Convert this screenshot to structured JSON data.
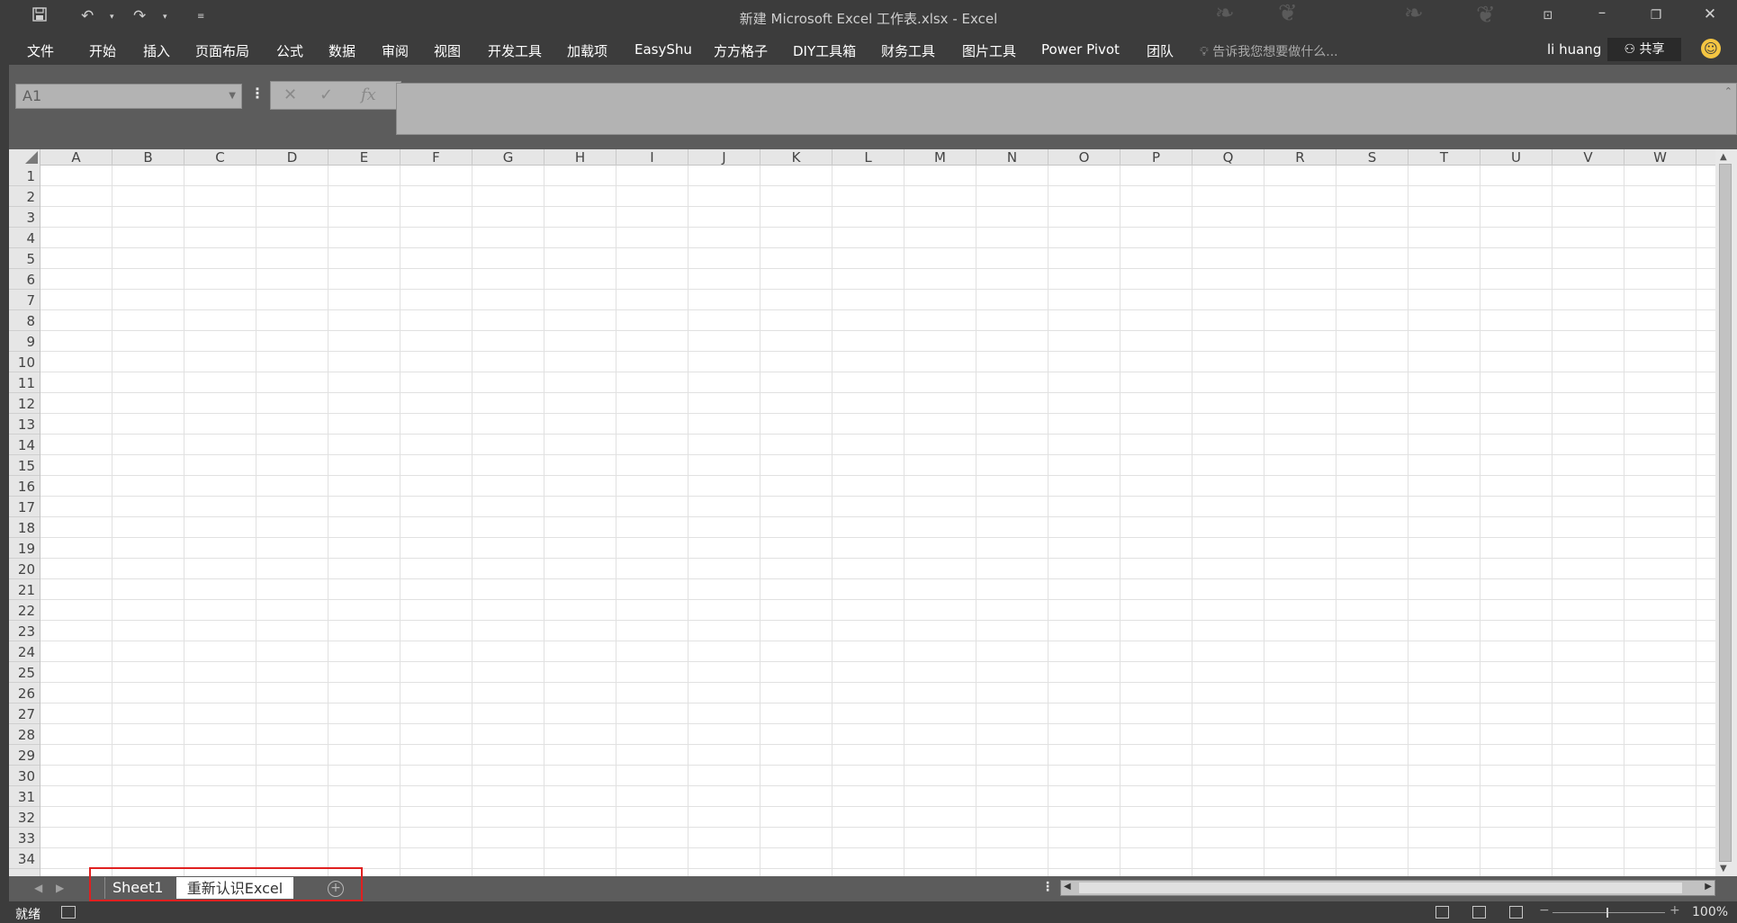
{
  "window": {
    "title": "新建 Microsoft Excel 工作表.xlsx - Excel",
    "qat": {
      "save_icon": "save-icon",
      "undo_icon": "undo-icon",
      "redo_icon": "redo-icon",
      "customize_icon": "customize-icon"
    },
    "controls": {
      "ribbon_display_icon": "ribbon-display-icon",
      "minimize_icon": "minimize-icon",
      "restore_icon": "restore-icon",
      "close_icon": "close-icon"
    }
  },
  "ribbon": {
    "tabs": [
      "文件",
      "开始",
      "插入",
      "页面布局",
      "公式",
      "数据",
      "审阅",
      "视图",
      "开发工具",
      "加载项",
      "EasyShu",
      "方方格子",
      "DIY工具箱",
      "财务工具",
      "图片工具",
      "Power Pivot",
      "团队"
    ],
    "tell_me": "告诉我您想要做什么...",
    "user": "li huang",
    "share": "共享"
  },
  "formula": {
    "name_box": "A1",
    "cancel": "✕",
    "enter": "✓",
    "fx": "fx",
    "value": ""
  },
  "grid": {
    "columns": [
      "A",
      "B",
      "C",
      "D",
      "E",
      "F",
      "G",
      "H",
      "I",
      "J",
      "K",
      "L",
      "M",
      "N",
      "O",
      "P",
      "Q",
      "R",
      "S",
      "T",
      "U",
      "V",
      "W"
    ],
    "rows": [
      "1",
      "2",
      "3",
      "4",
      "5",
      "6",
      "7",
      "8",
      "9",
      "10",
      "11",
      "12",
      "13",
      "14",
      "15",
      "16",
      "17",
      "18",
      "19",
      "20",
      "21",
      "22",
      "23",
      "24",
      "25",
      "26",
      "27",
      "28",
      "29",
      "30",
      "31",
      "32",
      "33",
      "34"
    ]
  },
  "sheets": {
    "tabs": [
      "Sheet1",
      "重新认识Excel"
    ],
    "active": "重新认识Excel",
    "highlight_color": "#e02020"
  },
  "status": {
    "ready": "就绪",
    "zoom": "100%",
    "minus": "−",
    "plus": "+"
  },
  "colors": {
    "chrome": "#3c3c3c",
    "panel": "#5c5c5c",
    "gridline": "#e1e1e1"
  }
}
